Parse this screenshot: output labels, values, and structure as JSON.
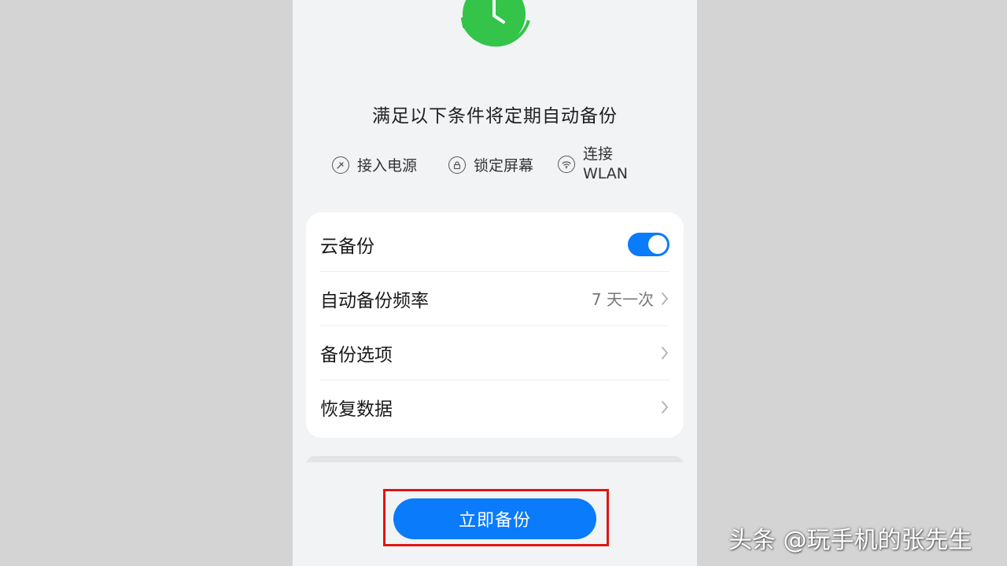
{
  "colors": {
    "accent": "#0a7bfa",
    "success": "#34c44a",
    "highlight": "#e01515",
    "background": "#f1f3f5"
  },
  "header": {
    "icon": "backup-clock-icon",
    "headline": "满足以下条件将定期自动备份"
  },
  "conditions": [
    {
      "icon": "power-plug-icon",
      "label": "接入电源"
    },
    {
      "icon": "lock-icon",
      "label": "锁定屏幕"
    },
    {
      "icon": "wifi-icon",
      "label_line1": "连接",
      "label_line2": "WLAN"
    }
  ],
  "settings": {
    "cloud_backup": {
      "label": "云备份",
      "enabled": true
    },
    "frequency": {
      "label": "自动备份频率",
      "value": "7 天一次"
    },
    "options": {
      "label": "备份选项"
    },
    "restore": {
      "label": "恢复数据"
    }
  },
  "actions": {
    "backup_now": "立即备份"
  },
  "watermark": "头条 @玩手机的张先生"
}
